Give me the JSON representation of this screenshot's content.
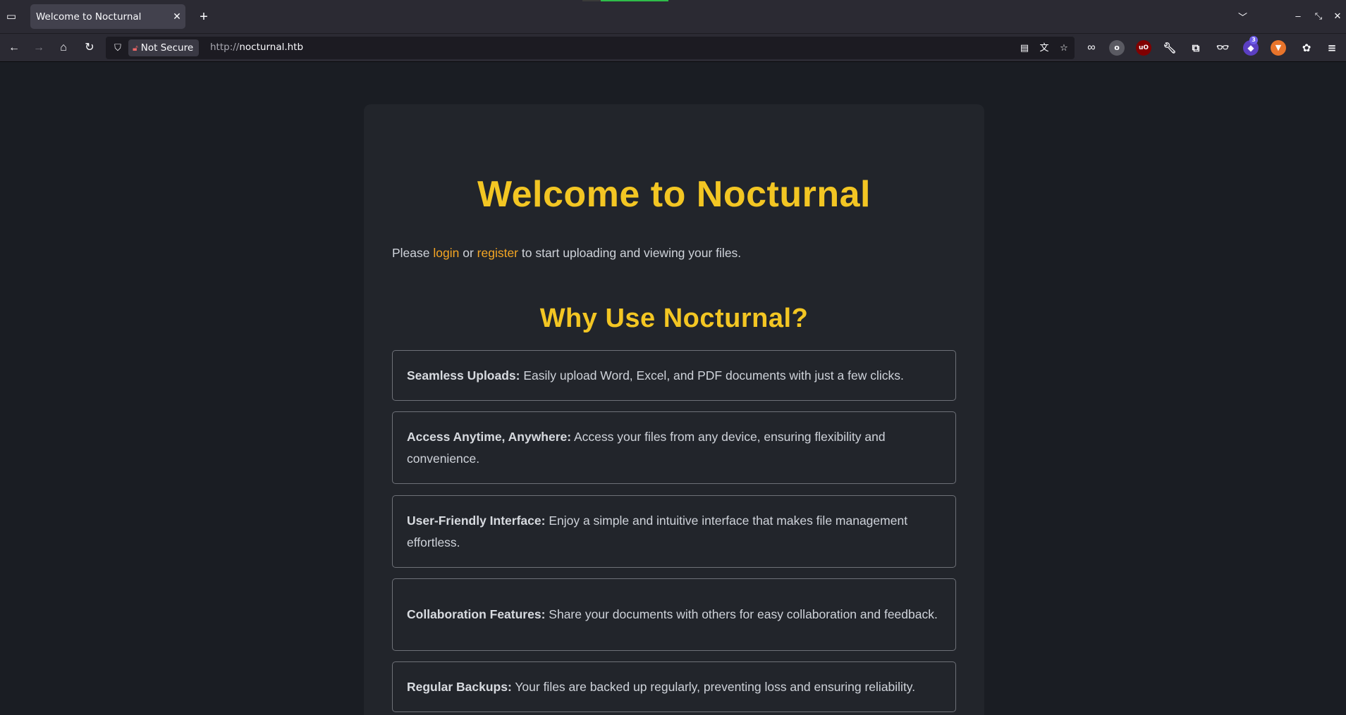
{
  "browser": {
    "tab_title": "Welcome to Nocturnal",
    "tab_close": "✕",
    "new_tab": "+",
    "security_label": "Not Secure",
    "url_prefix": "http://",
    "url_host": "nocturnal.htb",
    "extension_badge": "3"
  },
  "page": {
    "title": "Welcome to Nocturnal",
    "intro": {
      "before": "Please ",
      "login_link": "login",
      "middle": " or ",
      "register_link": "register",
      "after": " to start uploading and viewing your files."
    },
    "section_title": "Why Use Nocturnal?",
    "features": [
      {
        "label": "Seamless Uploads:",
        "text": " Easily upload Word, Excel, and PDF documents with just a few clicks."
      },
      {
        "label": "Access Anytime, Anywhere:",
        "text": " Access your files from any device, ensuring flexibility and convenience."
      },
      {
        "label": "User-Friendly Interface:",
        "text": " Enjoy a simple and intuitive interface that makes file management effortless."
      },
      {
        "label": "Collaboration Features:",
        "text": " Share your documents with others for easy collaboration and feedback."
      },
      {
        "label": "Regular Backups:",
        "text": " Your files are backed up regularly, preventing loss and ensuring reliability."
      }
    ]
  },
  "colors": {
    "accent_yellow": "#f3c623",
    "link_orange": "#f5a623",
    "page_bg": "#1a1d23",
    "card_bg": "#22252b"
  }
}
